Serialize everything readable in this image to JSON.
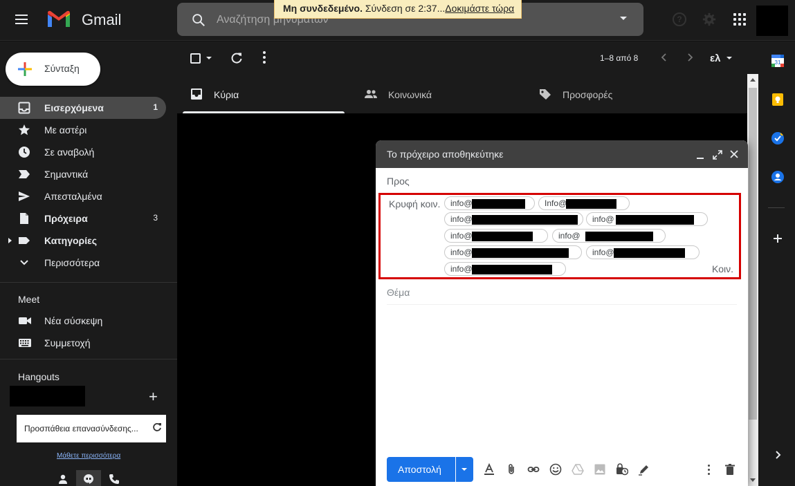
{
  "header": {
    "app_name": "Gmail",
    "search_placeholder": "Αναζήτηση μηνυμάτων",
    "offline_bold": "Μη συνδεδεμένο.",
    "offline_text": " Σύνδεση σε 2:37...",
    "offline_link": "Δοκιμάστε τώρα"
  },
  "sidebar": {
    "compose_label": "Σύνταξη",
    "items": [
      {
        "label": "Εισερχόμενα",
        "count": "1",
        "icon": "inbox-icon"
      },
      {
        "label": "Με αστέρι",
        "count": "",
        "icon": "star-icon"
      },
      {
        "label": "Σε αναβολή",
        "count": "",
        "icon": "clock-icon"
      },
      {
        "label": "Σημαντικά",
        "count": "",
        "icon": "important-icon"
      },
      {
        "label": "Απεσταλμένα",
        "count": "",
        "icon": "send-icon"
      },
      {
        "label": "Πρόχειρα",
        "count": "3",
        "icon": "draft-icon"
      },
      {
        "label": "Κατηγορίες",
        "count": "",
        "icon": "label-icon"
      },
      {
        "label": "Περισσότερα",
        "count": "",
        "icon": "chevron-down-icon"
      }
    ],
    "meet_title": "Meet",
    "meet_new": "Νέα σύσκεψη",
    "meet_join": "Συμμετοχή",
    "hangouts_title": "Hangouts",
    "reconnect_text": "Προσπάθεια επανασύνδεσης...",
    "learn_more": "Μάθετε περισσότερα"
  },
  "toolbar": {
    "pages": "1–8 από 8",
    "lang": "ελ"
  },
  "tabs": [
    {
      "label": "Κύρια",
      "icon": "inbox-icon"
    },
    {
      "label": "Κοινωνικά",
      "icon": "people-icon"
    },
    {
      "label": "Προσφορές",
      "icon": "tag-icon"
    }
  ],
  "compose": {
    "title": "Το πρόχειρο αποθηκεύτηκε",
    "to_label": "Προς",
    "bcc_label": "Κρυφή κοιν.",
    "cc_label": "Κοιν.",
    "chips": [
      "info@",
      "Info@",
      "info@",
      "info@",
      "info@",
      "info@",
      "info@",
      "info@",
      "info@"
    ],
    "subject_placeholder": "Θέμα",
    "send_label": "Αποστολή"
  },
  "colors": {
    "accent_blue": "#1a73e8",
    "highlight_red": "#d50000",
    "offline_banner": "#f9edbe"
  }
}
